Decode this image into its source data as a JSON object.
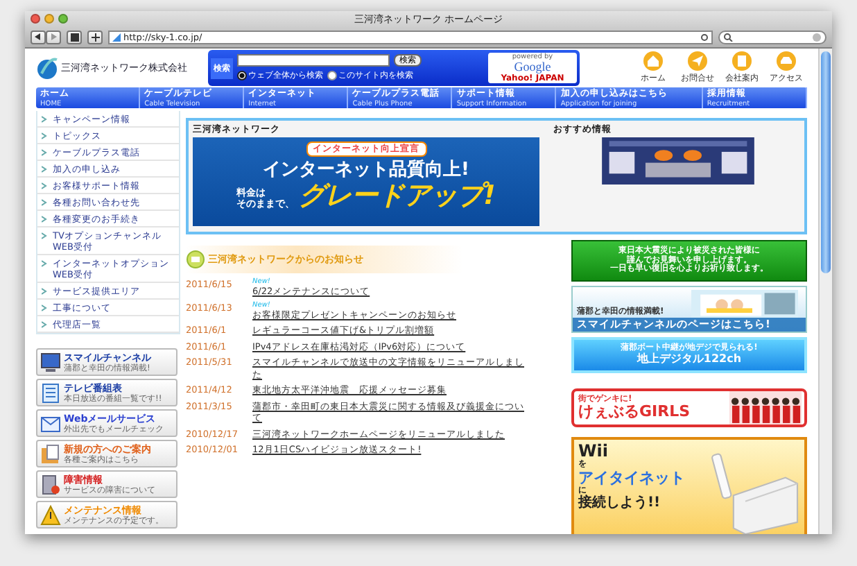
{
  "window": {
    "title": "三河湾ネットワーク ホームページ"
  },
  "toolbar": {
    "url": "http://sky-1.co.jp/"
  },
  "header": {
    "company": "三河湾ネットワーク株式会社",
    "search": {
      "label": "検索",
      "button": "検索",
      "powered": "powered by",
      "engine": "Google",
      "partner": "Yahoo! JAPAN",
      "options": [
        {
          "label": "ウェブ全体から検索",
          "selected": true
        },
        {
          "label": "このサイト内を検索",
          "selected": false
        }
      ]
    },
    "icons": [
      {
        "label": "ホーム",
        "kind": "home"
      },
      {
        "label": "お問合せ",
        "kind": "mail"
      },
      {
        "label": "会社案内",
        "kind": "building"
      },
      {
        "label": "アクセス",
        "kind": "car"
      }
    ]
  },
  "nav": [
    {
      "label": "ホーム",
      "sub": "HOME"
    },
    {
      "label": "ケーブルテレビ",
      "sub": "Cable Television"
    },
    {
      "label": "インターネット",
      "sub": "Internet"
    },
    {
      "label": "ケーブルプラス電話",
      "sub": "Cable Plus Phone"
    },
    {
      "label": "サポート情報",
      "sub": "Support Information"
    },
    {
      "label": "加入の申し込みはこちら",
      "sub": "Application for joining"
    },
    {
      "label": "採用情報",
      "sub": "Recruitment"
    }
  ],
  "sidebar": [
    "キャンペーン情報",
    "トピックス",
    "ケーブルプラス電話",
    "加入の申し込み",
    "お客様サポート情報",
    "各種お問い合わせ先",
    "各種変更のお手続き",
    "TVオプションチャンネルWEB受付",
    "インターネットオプションWEB受付",
    "サービス提供エリア",
    "工事について",
    "代理店一覧"
  ],
  "side_banners": [
    {
      "kind": "monitor",
      "title": "スマイルチャンネル",
      "sub": "蒲郡と幸田の情報満載!",
      "color": "#1d3fa6"
    },
    {
      "kind": "list",
      "title": "テレビ番組表",
      "sub": "本日放送の番組一覧です!!",
      "color": "#1d3fa6"
    },
    {
      "kind": "mail",
      "title": "Webメールサービス",
      "sub": "外出先でもメールチェック",
      "color": "#2a3fd0"
    },
    {
      "kind": "folder",
      "title": "新規の方へのご案内",
      "sub": "各種ご案内はこちら",
      "color": "#e0601a"
    },
    {
      "kind": "server",
      "title": "障害情報",
      "sub": "サービスの障害について",
      "color": "#d42020"
    },
    {
      "kind": "warning",
      "title": "メンテナンス情報",
      "sub": "メンテナンスの予定です。",
      "color": "#f08a00"
    }
  ],
  "top_box": {
    "title": "三河湾ネットワーク",
    "recommend_title": "おすすめ情報",
    "banner": {
      "badge": "インターネット向上宣言",
      "headline": "インターネット品質向上!",
      "note_1": "料金は",
      "note_2": "そのままで、",
      "big": "グレードアップ!"
    }
  },
  "news": {
    "title": "三河湾ネットワークからのお知らせ",
    "items": [
      {
        "date": "2011/6/15",
        "badge": "New!",
        "text": "6/22メンテナンスについて"
      },
      {
        "date": "2011/6/13",
        "badge": "New!",
        "text": "お客様限定プレゼントキャンペーンのお知らせ"
      },
      {
        "date": "2011/6/1",
        "text": "レギュラーコース値下げ&トリプル割増額"
      },
      {
        "date": "2011/6/1",
        "text": "IPv4アドレス在庫枯渇対応（IPv6対応）について"
      },
      {
        "date": "2011/5/31",
        "text": "スマイルチャンネルで放送中の文字情報をリニューアルしました"
      },
      {
        "date": "2011/4/12",
        "text": "東北地方太平洋沖地震　応援メッセージ募集"
      },
      {
        "date": "2011/3/15",
        "text": "蒲郡市・幸田町の東日本大震災に関する情報及び義援金について"
      },
      {
        "date": "2010/12/17",
        "text": "三河湾ネットワークホームページをリニューアルしました"
      },
      {
        "date": "2010/12/01",
        "text": "12月1日CSハイビジョン放送スタート!"
      }
    ]
  },
  "right_banners": [
    {
      "kind": "notice",
      "lines": [
        "東日本大震災により被災された皆様に",
        "謹んでお見舞いを申し上げます。",
        "一日も早い復旧を心よりお祈り致します。"
      ]
    },
    {
      "kind": "smile",
      "lines": [
        "蒲郡と幸田の情報満載!",
        "スマイルチャンネルのページはこちら!"
      ]
    },
    {
      "kind": "digital",
      "lines": [
        "蒲郡ボート中継が地デジで見られる!",
        "地上デジタル122ch"
      ]
    },
    {
      "kind": "girls",
      "lines": [
        "街でゲンキに!",
        "けぇぶるGIRLS"
      ]
    },
    {
      "kind": "wii",
      "lines": [
        "Wii",
        "を",
        "アイタイネット",
        "に",
        "接続しよう!!"
      ]
    }
  ]
}
